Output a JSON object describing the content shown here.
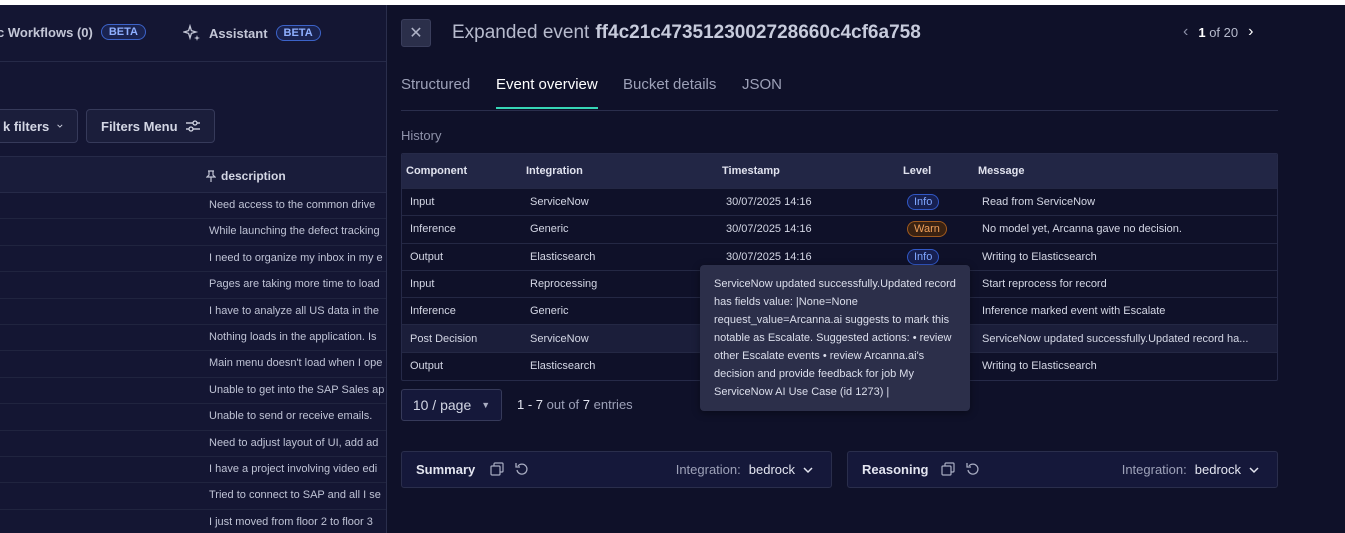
{
  "background": {
    "nav": [
      {
        "label": "c Workflows (0)",
        "badge": "BETA"
      },
      {
        "label": "Assistant",
        "badge": "BETA"
      }
    ],
    "quick_filters_label": "k filters",
    "filters_menu_label": "Filters Menu",
    "description_header": "description",
    "rows": [
      "Need access to the common drive",
      "While launching the defect tracking",
      "I need to organize my inbox in my e",
      "Pages are taking more time to load",
      "I have to analyze all US data in the",
      "Nothing loads in the application. Is",
      "Main menu doesn't load when I ope",
      "Unable to get into the SAP Sales ap",
      "Unable to send or receive emails.",
      "Need to adjust layout of UI, add ad",
      "I have a project involving video edi",
      "Tried to connect to SAP and all I se",
      "I just moved from floor 2 to floor 3"
    ]
  },
  "drawer": {
    "title_prefix": "Expanded event",
    "event_id": "ff4c21c4735123002728660c4cf6a758",
    "pager": {
      "current": "1",
      "of_label": "of 20"
    },
    "tabs": [
      "Structured",
      "Event overview",
      "Bucket details",
      "JSON"
    ],
    "history_label": "History",
    "table": {
      "headers": [
        "Component",
        "Integration",
        "Timestamp",
        "Level",
        "Message"
      ],
      "rows": [
        {
          "component": "Input",
          "integration": "ServiceNow",
          "timestamp": "30/07/2025 14:16",
          "level": "Info",
          "message": "Read from ServiceNow"
        },
        {
          "component": "Inference",
          "integration": "Generic",
          "timestamp": "30/07/2025 14:16",
          "level": "Warn",
          "message": "No model yet, Arcanna gave no decision."
        },
        {
          "component": "Output",
          "integration": "Elasticsearch",
          "timestamp": "30/07/2025 14:16",
          "level": "Info",
          "message": "Writing to Elasticsearch"
        },
        {
          "component": "Input",
          "integration": "Reprocessing",
          "timestamp": "",
          "level": "",
          "message": "Start reprocess for record"
        },
        {
          "component": "Inference",
          "integration": "Generic",
          "timestamp": "",
          "level": "",
          "message": "Inference marked event with Escalate"
        },
        {
          "component": "Post Decision",
          "integration": "ServiceNow",
          "timestamp": "",
          "level": "",
          "message": "ServiceNow updated successfully.Updated record ha..."
        },
        {
          "component": "Output",
          "integration": "Elasticsearch",
          "timestamp": "",
          "level": "",
          "message": "Writing to Elasticsearch"
        }
      ]
    },
    "tooltip": "ServiceNow updated successfully.Updated record has fields value: |None=None request_value=Arcanna.ai suggests to mark this notable as Escalate. Suggested actions: • review other Escalate events • review Arcanna.ai's decision and provide feedback for job My ServiceNow AI Use Case (id 1273) |",
    "per_page": "10 / page",
    "entries": {
      "range": "1 - 7",
      "out_of": "out of",
      "total": "7",
      "suffix": "entries"
    },
    "panels": [
      {
        "title": "Summary",
        "integration_label": "Integration:",
        "integration_value": "bedrock"
      },
      {
        "title": "Reasoning",
        "integration_label": "Integration:",
        "integration_value": "bedrock"
      }
    ]
  }
}
